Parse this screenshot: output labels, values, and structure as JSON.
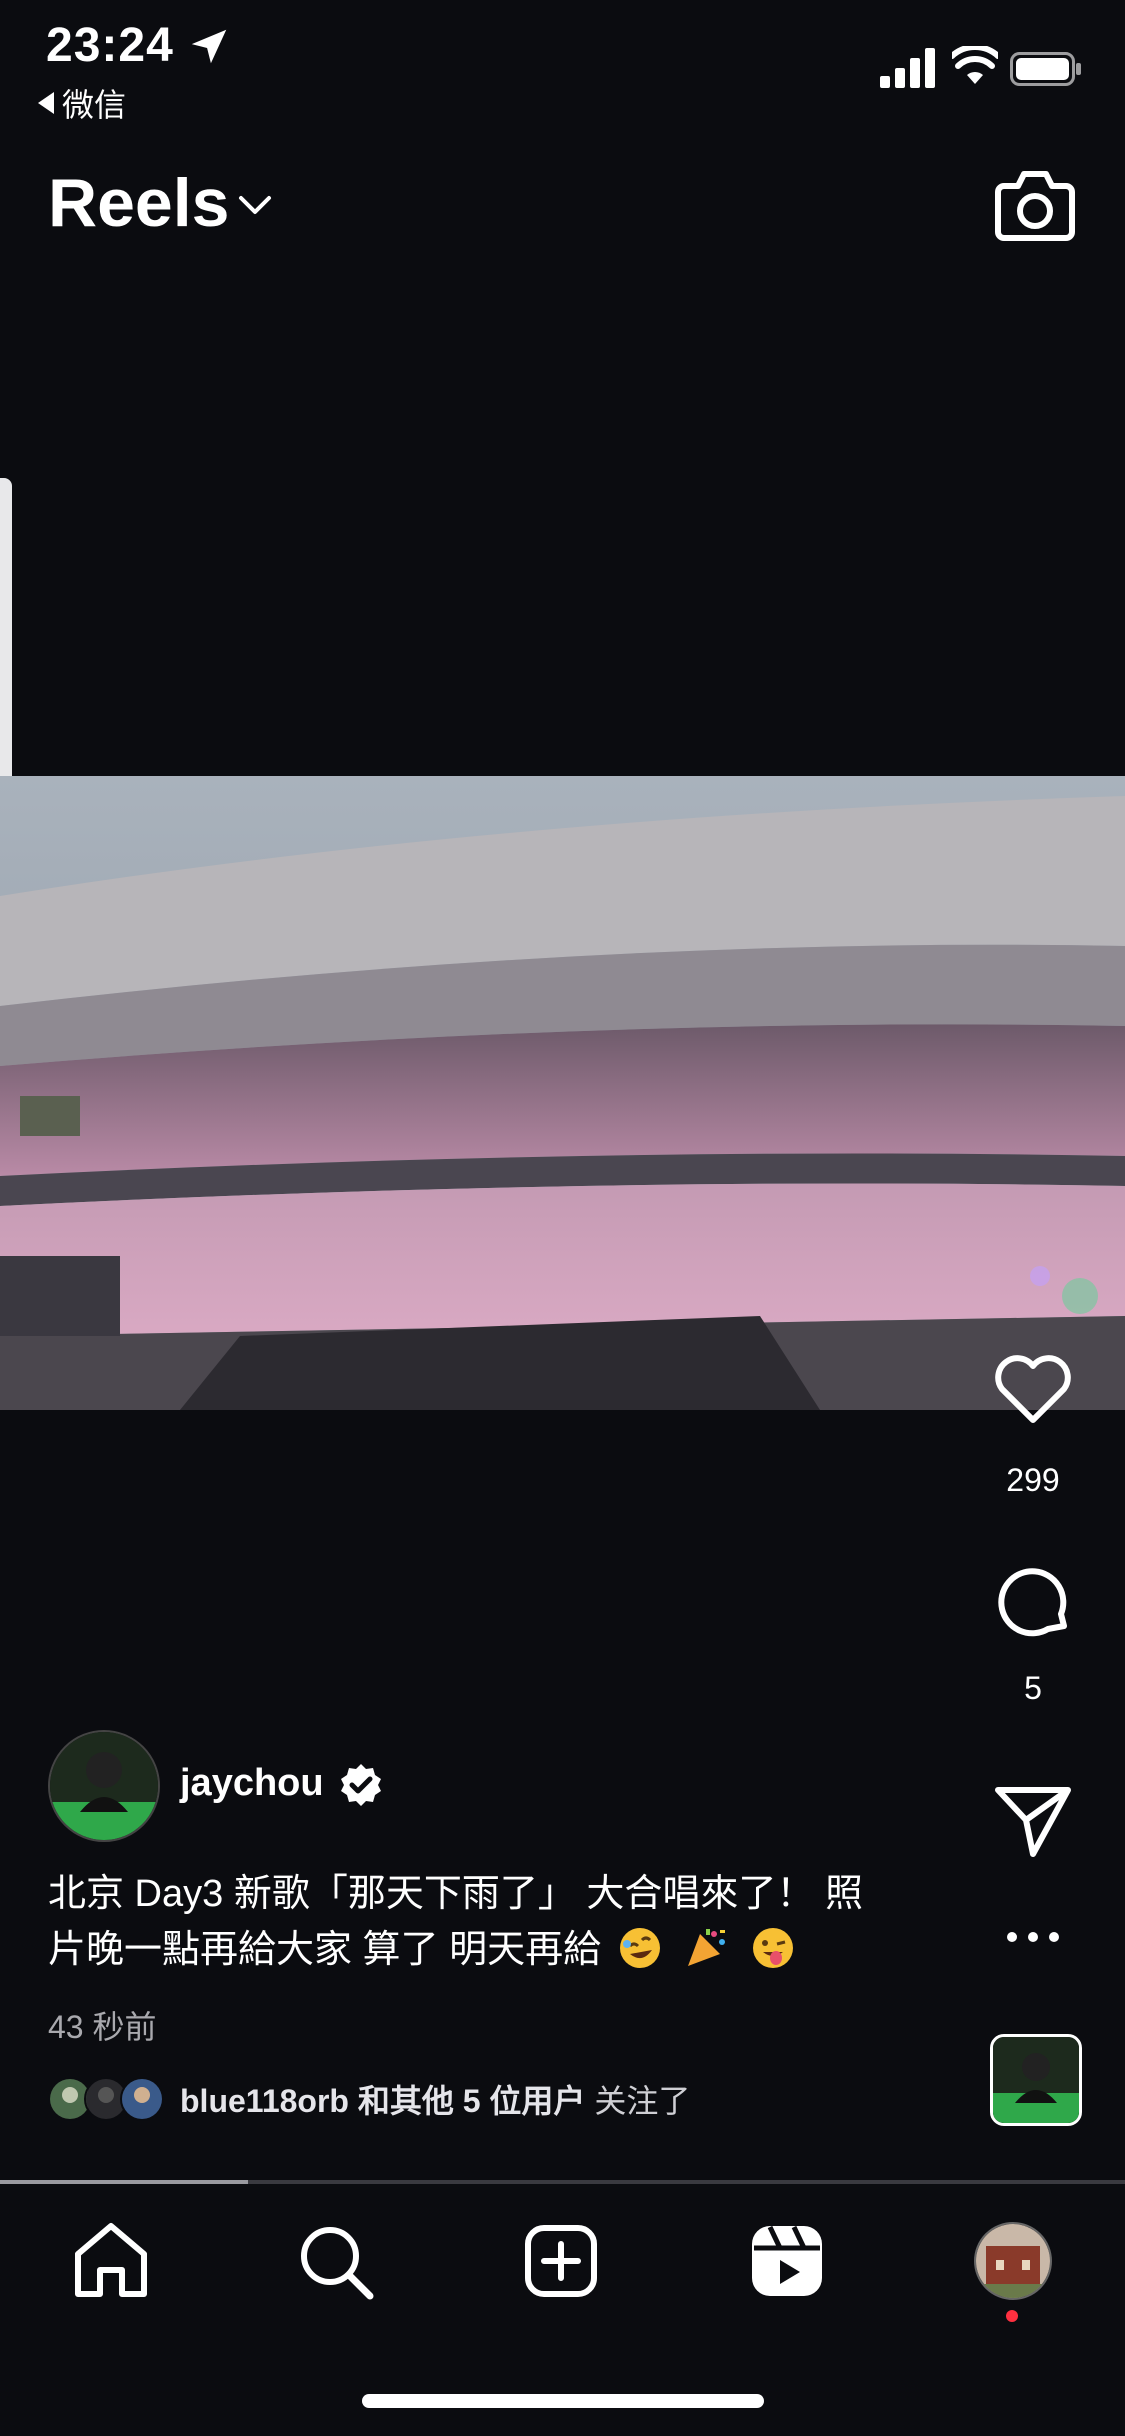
{
  "status_bar": {
    "time": "23:24",
    "back_app": "微信",
    "location_icon": "location-arrow-icon",
    "signal_icon": "cellular-signal-icon",
    "wifi_icon": "wifi-icon",
    "battery_icon": "battery-icon"
  },
  "header": {
    "title": "Reels",
    "dropdown_icon": "chevron-down-icon",
    "camera_icon": "camera-icon"
  },
  "actions": {
    "like_icon": "heart-icon",
    "like_count": "299",
    "comment_icon": "comment-bubble-icon",
    "comment_count": "5",
    "share_icon": "paper-plane-icon",
    "more_icon": "more-dots-icon"
  },
  "post": {
    "username": "jaychou",
    "verified_icon": "verified-badge-icon",
    "caption_line1": "北京 Day3 新歌「那天下雨了」 大合唱來了！ 照",
    "caption_line2": "片晚一點再給大家 算了 明天再給",
    "caption_emojis": [
      "rolling-laughing-emoji",
      "party-popper-emoji",
      "winking-tongue-emoji"
    ],
    "time_ago": "43 秒前",
    "followers_name": "blue118orb",
    "followers_rest": " 和其他 5 位用户",
    "followers_suffix": "关注了"
  },
  "playback": {
    "progress_fraction": 0.22
  },
  "tab_bar": {
    "items": [
      "home-icon",
      "search-icon",
      "create-post-icon",
      "reels-icon",
      "profile-avatar"
    ]
  },
  "colors": {
    "background": "#0b0c10",
    "notification_dot": "#ff3040"
  }
}
